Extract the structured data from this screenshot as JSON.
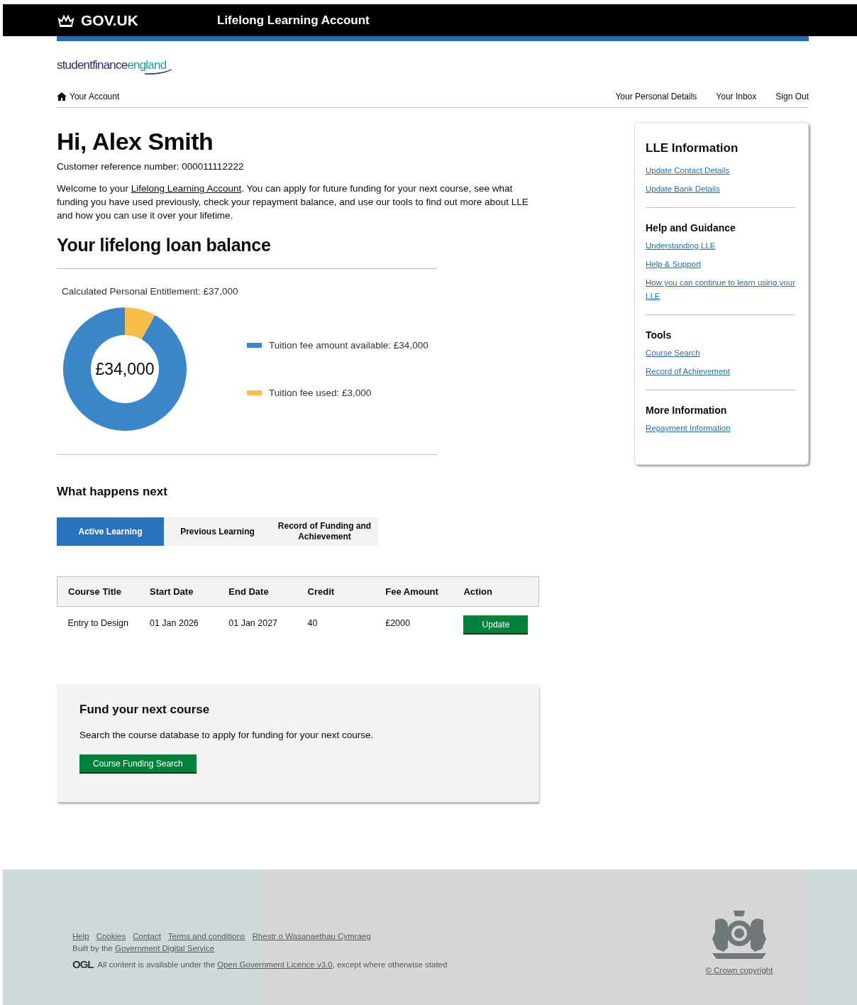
{
  "header": {
    "logo_text": "GOV.UK",
    "service_name": "Lifelong Learning Account"
  },
  "brand": {
    "part_1": "studentfinance",
    "part_2": "england"
  },
  "nav": {
    "home": "Your Account",
    "links": [
      "Your Personal Details",
      "Your Inbox",
      "Sign Out"
    ]
  },
  "greeting": "Hi, Alex Smith",
  "reference": "Customer reference number: 000011112222",
  "intro": {
    "before": "Welcome to your ",
    "link": "Lifelong Learning Account",
    "after": ". You can apply for future funding for your next course, see what funding you have used previously, check your repayment balance, and use our tools to find out more about LLE and how you can use it over your lifetime."
  },
  "balance": {
    "title": "Your lifelong loan balance",
    "entitlement": "Calculated Personal Entitlement: £37,000",
    "center_value": "£34,000",
    "chart_data": {
      "type": "donut",
      "categories": [
        "Tuition fee amount available: £34,000",
        "Tuition fee used: £3,000"
      ],
      "series": [
        {
          "values": [
            34000,
            3000
          ]
        }
      ]
    },
    "legend": [
      {
        "color": "#3a86c8"
      },
      {
        "color": "#f7be4a"
      }
    ]
  },
  "sidebar": [
    {
      "title": "LLE Information",
      "links": [
        "Update Contact Details",
        "Update Bank Details"
      ]
    },
    {
      "title": "Help and Guidance",
      "links": [
        "Understanding LLE",
        "Help & Support",
        "How you can continue to learn using your LLE"
      ]
    },
    {
      "title": "Tools",
      "links": [
        "Course Search",
        "Record of Achievement"
      ]
    },
    {
      "title": "More Information",
      "links": [
        "Repayment Information"
      ]
    }
  ],
  "next": {
    "title": "What happens next",
    "tabs": [
      {
        "label": "Active Learning",
        "selected": true
      },
      {
        "label": "Previous Learning",
        "selected": false
      },
      {
        "label": "Record of Funding and Achievement",
        "selected": false
      }
    ],
    "table": {
      "columns": [
        "Course Title",
        "Start Date",
        "End Date",
        "Credit",
        "Fee Amount",
        "Action"
      ],
      "rows": [
        {
          "cells": [
            "Entry to Design",
            "01 Jan 2026",
            "01 Jan 2027",
            "40",
            "£2000"
          ],
          "action": "Update"
        }
      ]
    }
  },
  "fund": {
    "title": "Fund your next course",
    "text": "Search the course database to apply for funding for your next course.",
    "button": "Course Funding Search"
  },
  "footer": {
    "links": [
      "Help",
      "Cookies",
      "Contact",
      "Terms and conditions",
      "Rhestr o Wasanaethau Cymraeg"
    ],
    "built_by": {
      "before": "Built by the ",
      "link": "Government Digital Service"
    },
    "licence": {
      "logo": "OGL",
      "before": "All content is available under the ",
      "link": "Open Government Licence v3.0",
      "after": ", except where otherwise stated"
    },
    "copyright": "© Crown copyright"
  }
}
